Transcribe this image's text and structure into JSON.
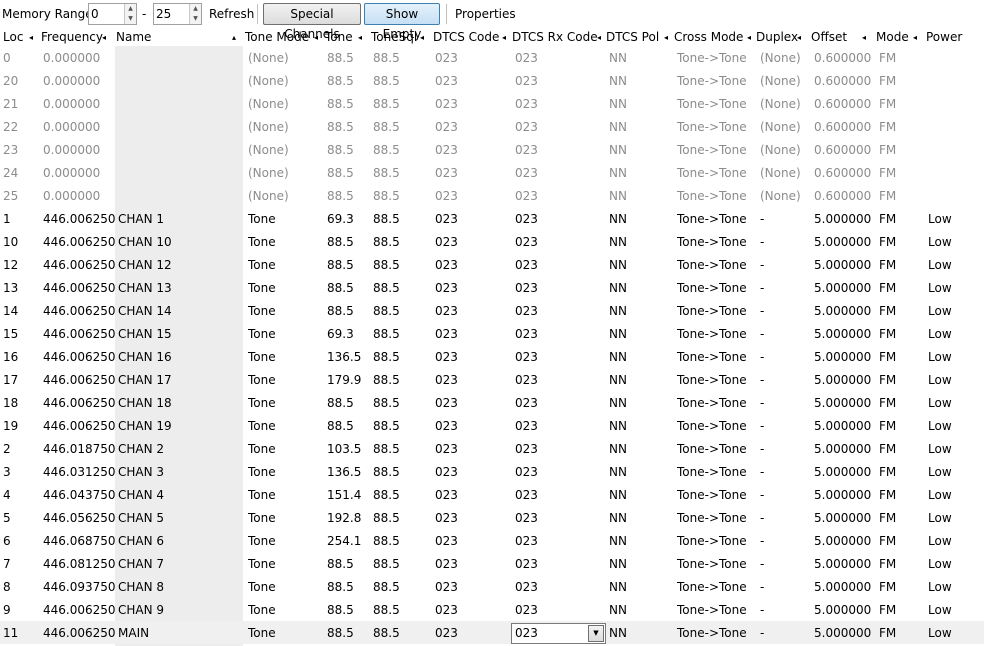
{
  "toolbar": {
    "memory_range_label": "Memory Range:",
    "range_start": "0",
    "range_dash": "-",
    "range_end": "25",
    "refresh_label": "Refresh",
    "special_channels_label": "Special Channels",
    "show_empty_label": "Show Empty",
    "properties_label": "Properties"
  },
  "columns": [
    {
      "label": "Loc",
      "sort": "◂"
    },
    {
      "label": "Frequency",
      "sort": "◂"
    },
    {
      "label": "Name",
      "sort": "▴"
    },
    {
      "label": "Tone Mode",
      "sort": "◂"
    },
    {
      "label": "Tone",
      "sort": "◂"
    },
    {
      "label": "ToneSql",
      "sort": "◂"
    },
    {
      "label": "DTCS Code",
      "sort": "◂"
    },
    {
      "label": "DTCS Rx Code",
      "sort": "◂"
    },
    {
      "label": "DTCS Pol",
      "sort": "◂"
    },
    {
      "label": "Cross Mode",
      "sort": "◂"
    },
    {
      "label": "Duplex",
      "sort": "◂"
    },
    {
      "label": "Offset",
      "sort": "◂"
    },
    {
      "label": "Mode",
      "sort": "◂"
    },
    {
      "label": "Power",
      "sort": ""
    }
  ],
  "rows": [
    {
      "empty": true,
      "cells": [
        "0",
        "0.000000",
        "",
        "(None)",
        "88.5",
        "88.5",
        "023",
        "023",
        "NN",
        "Tone->Tone",
        "(None)",
        "0.600000",
        "FM",
        ""
      ]
    },
    {
      "empty": true,
      "cells": [
        "20",
        "0.000000",
        "",
        "(None)",
        "88.5",
        "88.5",
        "023",
        "023",
        "NN",
        "Tone->Tone",
        "(None)",
        "0.600000",
        "FM",
        ""
      ]
    },
    {
      "empty": true,
      "cells": [
        "21",
        "0.000000",
        "",
        "(None)",
        "88.5",
        "88.5",
        "023",
        "023",
        "NN",
        "Tone->Tone",
        "(None)",
        "0.600000",
        "FM",
        ""
      ]
    },
    {
      "empty": true,
      "cells": [
        "22",
        "0.000000",
        "",
        "(None)",
        "88.5",
        "88.5",
        "023",
        "023",
        "NN",
        "Tone->Tone",
        "(None)",
        "0.600000",
        "FM",
        ""
      ]
    },
    {
      "empty": true,
      "cells": [
        "23",
        "0.000000",
        "",
        "(None)",
        "88.5",
        "88.5",
        "023",
        "023",
        "NN",
        "Tone->Tone",
        "(None)",
        "0.600000",
        "FM",
        ""
      ]
    },
    {
      "empty": true,
      "cells": [
        "24",
        "0.000000",
        "",
        "(None)",
        "88.5",
        "88.5",
        "023",
        "023",
        "NN",
        "Tone->Tone",
        "(None)",
        "0.600000",
        "FM",
        ""
      ]
    },
    {
      "empty": true,
      "cells": [
        "25",
        "0.000000",
        "",
        "(None)",
        "88.5",
        "88.5",
        "023",
        "023",
        "NN",
        "Tone->Tone",
        "(None)",
        "0.600000",
        "FM",
        ""
      ]
    },
    {
      "empty": false,
      "cells": [
        "1",
        "446.006250",
        "CHAN 1",
        "Tone",
        "69.3",
        "88.5",
        "023",
        "023",
        "NN",
        "Tone->Tone",
        "-",
        "5.000000",
        "FM",
        "Low"
      ]
    },
    {
      "empty": false,
      "cells": [
        "10",
        "446.006250",
        "CHAN 10",
        "Tone",
        "88.5",
        "88.5",
        "023",
        "023",
        "NN",
        "Tone->Tone",
        "-",
        "5.000000",
        "FM",
        "Low"
      ]
    },
    {
      "empty": false,
      "cells": [
        "12",
        "446.006250",
        "CHAN 12",
        "Tone",
        "88.5",
        "88.5",
        "023",
        "023",
        "NN",
        "Tone->Tone",
        "-",
        "5.000000",
        "FM",
        "Low"
      ]
    },
    {
      "empty": false,
      "cells": [
        "13",
        "446.006250",
        "CHAN 13",
        "Tone",
        "88.5",
        "88.5",
        "023",
        "023",
        "NN",
        "Tone->Tone",
        "-",
        "5.000000",
        "FM",
        "Low"
      ]
    },
    {
      "empty": false,
      "cells": [
        "14",
        "446.006250",
        "CHAN 14",
        "Tone",
        "88.5",
        "88.5",
        "023",
        "023",
        "NN",
        "Tone->Tone",
        "-",
        "5.000000",
        "FM",
        "Low"
      ]
    },
    {
      "empty": false,
      "cells": [
        "15",
        "446.006250",
        "CHAN 15",
        "Tone",
        "69.3",
        "88.5",
        "023",
        "023",
        "NN",
        "Tone->Tone",
        "-",
        "5.000000",
        "FM",
        "Low"
      ]
    },
    {
      "empty": false,
      "cells": [
        "16",
        "446.006250",
        "CHAN 16",
        "Tone",
        "136.5",
        "88.5",
        "023",
        "023",
        "NN",
        "Tone->Tone",
        "-",
        "5.000000",
        "FM",
        "Low"
      ]
    },
    {
      "empty": false,
      "cells": [
        "17",
        "446.006250",
        "CHAN 17",
        "Tone",
        "179.9",
        "88.5",
        "023",
        "023",
        "NN",
        "Tone->Tone",
        "-",
        "5.000000",
        "FM",
        "Low"
      ]
    },
    {
      "empty": false,
      "cells": [
        "18",
        "446.006250",
        "CHAN 18",
        "Tone",
        "88.5",
        "88.5",
        "023",
        "023",
        "NN",
        "Tone->Tone",
        "-",
        "5.000000",
        "FM",
        "Low"
      ]
    },
    {
      "empty": false,
      "cells": [
        "19",
        "446.006250",
        "CHAN 19",
        "Tone",
        "88.5",
        "88.5",
        "023",
        "023",
        "NN",
        "Tone->Tone",
        "-",
        "5.000000",
        "FM",
        "Low"
      ]
    },
    {
      "empty": false,
      "cells": [
        "2",
        "446.018750",
        "CHAN 2",
        "Tone",
        "103.5",
        "88.5",
        "023",
        "023",
        "NN",
        "Tone->Tone",
        "-",
        "5.000000",
        "FM",
        "Low"
      ]
    },
    {
      "empty": false,
      "cells": [
        "3",
        "446.031250",
        "CHAN 3",
        "Tone",
        "136.5",
        "88.5",
        "023",
        "023",
        "NN",
        "Tone->Tone",
        "-",
        "5.000000",
        "FM",
        "Low"
      ]
    },
    {
      "empty": false,
      "cells": [
        "4",
        "446.043750",
        "CHAN 4",
        "Tone",
        "151.4",
        "88.5",
        "023",
        "023",
        "NN",
        "Tone->Tone",
        "-",
        "5.000000",
        "FM",
        "Low"
      ]
    },
    {
      "empty": false,
      "cells": [
        "5",
        "446.056250",
        "CHAN 5",
        "Tone",
        "192.8",
        "88.5",
        "023",
        "023",
        "NN",
        "Tone->Tone",
        "-",
        "5.000000",
        "FM",
        "Low"
      ]
    },
    {
      "empty": false,
      "cells": [
        "6",
        "446.068750",
        "CHAN 6",
        "Tone",
        "254.1",
        "88.5",
        "023",
        "023",
        "NN",
        "Tone->Tone",
        "-",
        "5.000000",
        "FM",
        "Low"
      ]
    },
    {
      "empty": false,
      "cells": [
        "7",
        "446.081250",
        "CHAN 7",
        "Tone",
        "88.5",
        "88.5",
        "023",
        "023",
        "NN",
        "Tone->Tone",
        "-",
        "5.000000",
        "FM",
        "Low"
      ]
    },
    {
      "empty": false,
      "cells": [
        "8",
        "446.093750",
        "CHAN 8",
        "Tone",
        "88.5",
        "88.5",
        "023",
        "023",
        "NN",
        "Tone->Tone",
        "-",
        "5.000000",
        "FM",
        "Low"
      ]
    },
    {
      "empty": false,
      "cells": [
        "9",
        "446.006250",
        "CHAN 9",
        "Tone",
        "88.5",
        "88.5",
        "023",
        "023",
        "NN",
        "Tone->Tone",
        "-",
        "5.000000",
        "FM",
        "Low"
      ]
    },
    {
      "empty": false,
      "selected": true,
      "cells": [
        "11",
        "446.006250",
        "MAIN",
        "Tone",
        "88.5",
        "88.5",
        "023",
        "023",
        "NN",
        "Tone->Tone",
        "-",
        "5.000000",
        "FM",
        "Low"
      ]
    }
  ],
  "editor": {
    "value": "023",
    "icon": "dropdown-arrow-icon"
  },
  "colors": {
    "empty_text": "#8c8c8c",
    "name_column_bg": "#ededed",
    "selected_row_bg": "#f0f0f0"
  }
}
